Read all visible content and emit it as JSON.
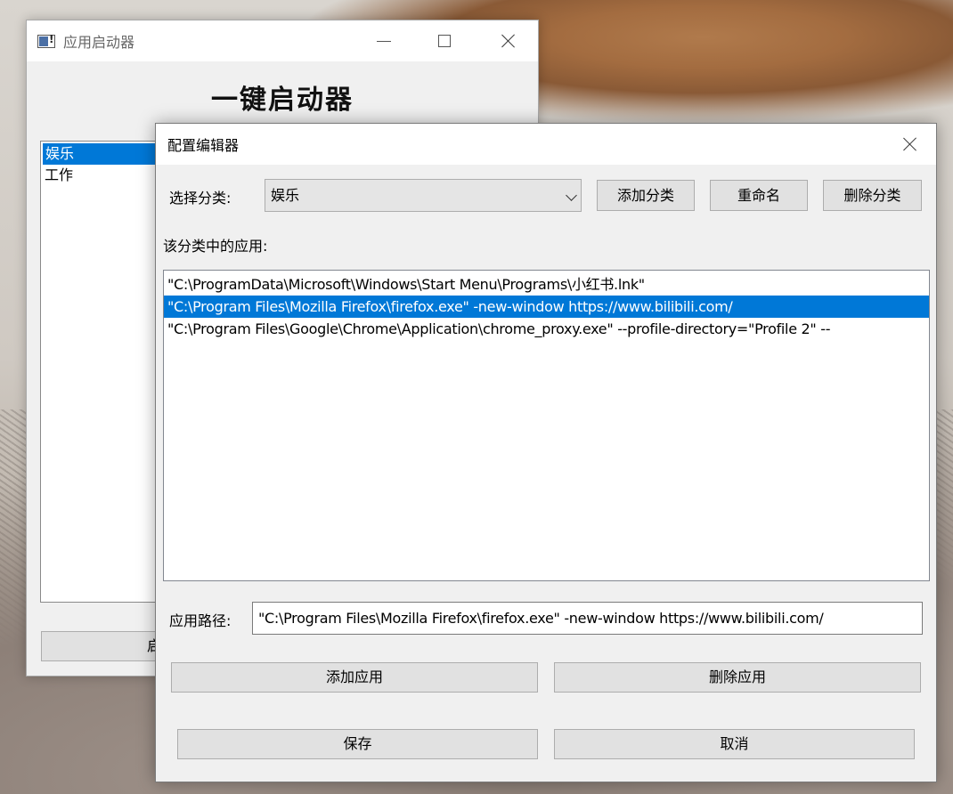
{
  "main_window": {
    "title": "应用启动器",
    "heading": "一键启动器",
    "categories": [
      {
        "label": "娱乐",
        "selected": true
      },
      {
        "label": "工作",
        "selected": false
      }
    ],
    "launch_button_label": "启"
  },
  "dialog": {
    "title": "配置编辑器",
    "category_label": "选择分类:",
    "category_selected": "娱乐",
    "add_category_label": "添加分类",
    "rename_label": "重命名",
    "delete_category_label": "删除分类",
    "apps_label": "该分类中的应用:",
    "apps": [
      {
        "label": "\"C:\\ProgramData\\Microsoft\\Windows\\Start Menu\\Programs\\小红书.lnk\"",
        "selected": false
      },
      {
        "label": "\"C:\\Program Files\\Mozilla Firefox\\firefox.exe\" -new-window https://www.bilibili.com/",
        "selected": true
      },
      {
        "label": "\"C:\\Program Files\\Google\\Chrome\\Application\\chrome_proxy.exe\" --profile-directory=\"Profile 2\" --",
        "selected": false
      }
    ],
    "path_label": "应用路径:",
    "path_value": "\"C:\\Program Files\\Mozilla Firefox\\firefox.exe\" -new-window https://www.bilibili.com/",
    "add_app_label": "添加应用",
    "delete_app_label": "删除应用",
    "save_label": "保存",
    "cancel_label": "取消"
  }
}
